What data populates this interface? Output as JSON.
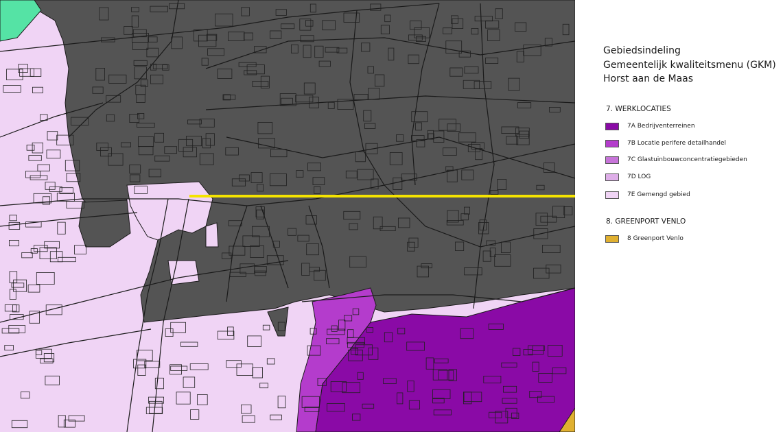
{
  "legend": {
    "title_lines": [
      "Gebiedsindeling",
      "Gemeentelijk kwaliteitsmenu (GKM)",
      "Horst aan de Maas"
    ],
    "sections": [
      {
        "heading": "7. WERKLOCATIES",
        "items": [
          {
            "label": "7A Bedrijventerreinen",
            "color": "#8a0aa6"
          },
          {
            "label": "7B Locatie perifere detailhandel",
            "color": "#b43ccc"
          },
          {
            "label": "7C Glastuinbouwconcentratiegebieden",
            "color": "#c774d9"
          },
          {
            "label": "7D LOG",
            "color": "#deaee8"
          },
          {
            "label": "7E Gemengd gebied",
            "color": "#f0d4f5"
          }
        ]
      },
      {
        "heading": "8. GREENPORT VENLO",
        "items": [
          {
            "label": "8 Greenport Venlo",
            "color": "#e0b030"
          }
        ]
      }
    ]
  },
  "map": {
    "colors": {
      "urban": "#545454",
      "mixed_area": "#f0d4f5",
      "industrial": "#8a0aa6",
      "retail": "#b43ccc",
      "greenport": "#e0b030",
      "green_zone": "#55e3a5",
      "highlight_line": "#f5e400"
    },
    "highlighted_item": "7E Gemengd gebied"
  }
}
